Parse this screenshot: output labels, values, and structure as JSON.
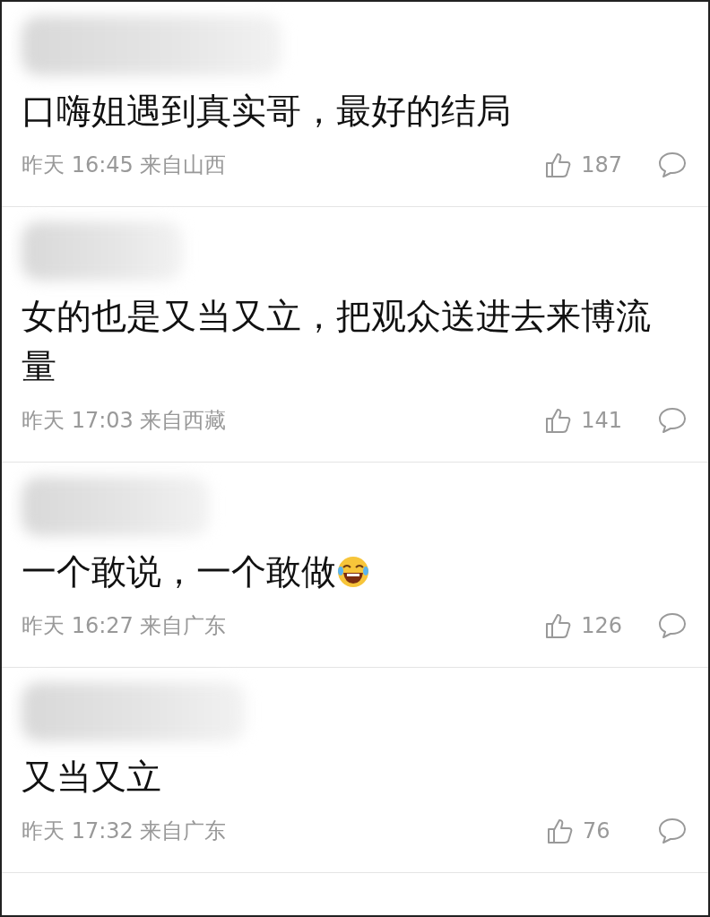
{
  "comments": [
    {
      "text": "口嗨姐遇到真实哥，最好的结局",
      "emoji": false,
      "meta": "昨天 16:45 来自山西",
      "likes": "187"
    },
    {
      "text": "女的也是又当又立，把观众送进去来博流量",
      "emoji": false,
      "meta": "昨天 17:03 来自西藏",
      "likes": "141"
    },
    {
      "text": "一个敢说，一个敢做",
      "emoji": true,
      "meta": "昨天 16:27 来自广东",
      "likes": "126"
    },
    {
      "text": "又当又立",
      "emoji": false,
      "meta": "昨天 17:32 来自广东",
      "likes": "76"
    }
  ]
}
